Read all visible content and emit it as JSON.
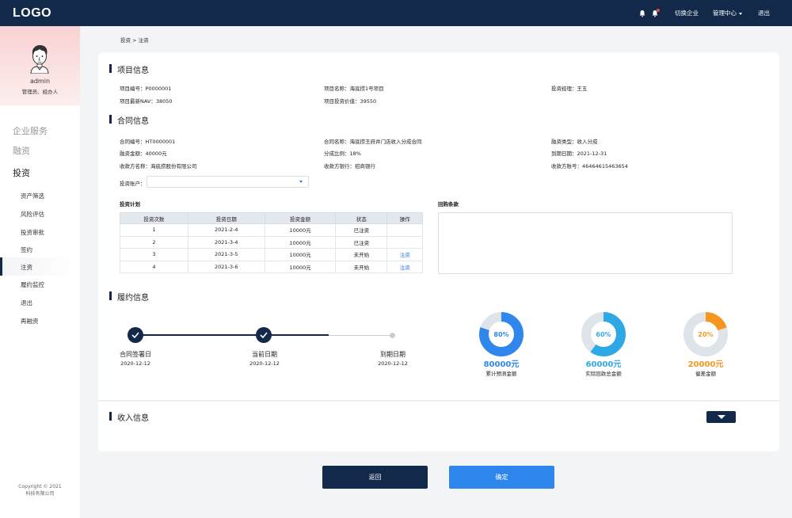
{
  "topbar": {
    "logo": "LOGO",
    "switch_company": "切换企业",
    "admin_center": "管理中心",
    "logout": "退出"
  },
  "profile": {
    "name": "admin",
    "role": "管理员、经办人"
  },
  "sidebar": {
    "groups": [
      "企业服务",
      "融资",
      "投资"
    ],
    "items": [
      "资产筛选",
      "风险评估",
      "投资审批",
      "签约",
      "注资",
      "履约监控",
      "退出",
      "再融资"
    ],
    "active_item": "注资",
    "copyright_line1": "Copyright © 2021",
    "copyright_line2": "科技有限公司"
  },
  "breadcrumb": "投资 > 注资",
  "project": {
    "title": "项目信息",
    "code": "项目编号：P0000001",
    "name": "项目名称：海底捞1号项目",
    "manager": "投资经理：王五",
    "nav": "项目最新NAV：38050",
    "value": "项目投资价值：39550"
  },
  "contract": {
    "title": "合同信息",
    "code": "合同编号：HT0000001",
    "name": "合同名称：海底捞王府井门店收入分成合同",
    "type": "融资类型：收入分成",
    "amount": "融资金额：40000元",
    "ratio": "分成比例：18%",
    "due": "到期日期：2021-12-31",
    "payee": "收款方名称：海底捞股份有限公司",
    "bank": "收款方银行：招商银行",
    "account": "收款方账号：46464615463654",
    "invest_account_label": "投资账户："
  },
  "plan": {
    "title": "投资计划",
    "headers": [
      "投资次数",
      "投资日期",
      "投资金额",
      "状态",
      "操作"
    ],
    "rows": [
      [
        "1",
        "2021-2-4",
        "10000元",
        "已注资",
        ""
      ],
      [
        "2",
        "2021-3-4",
        "10000元",
        "已注资",
        ""
      ],
      [
        "3",
        "2021-3-5",
        "10000元",
        "未开始",
        "注资"
      ],
      [
        "4",
        "2021-3-6",
        "10000元",
        "未开始",
        "注资"
      ]
    ]
  },
  "repurchase": {
    "title": "回购条款"
  },
  "performance": {
    "title": "履约信息",
    "milestones": [
      {
        "label": "合同签署日",
        "date": "2020-12-12"
      },
      {
        "label": "当前日期",
        "date": "2020-12-12"
      },
      {
        "label": "到期日期",
        "date": "2020-12-12"
      }
    ],
    "donuts": [
      {
        "percent": 0.8,
        "center": "80%",
        "value": "80000元",
        "label": "累计预测金额",
        "color": "#2f86ec",
        "track": "#dfe3ea",
        "valueColor": "#2f86ec"
      },
      {
        "percent": 0.6,
        "center": "60%",
        "value": "60000元",
        "label": "实际回款总金额",
        "color": "#2fa9e6",
        "track": "#dfe3ea",
        "valueColor": "#2fa9e6"
      },
      {
        "percent": 0.2,
        "center": "20%",
        "value": "20000元",
        "label": "偏差金额",
        "color": "#f7961e",
        "track": "#dfe3ea",
        "valueColor": "#f7961e"
      }
    ]
  },
  "income": {
    "title": "收入信息"
  },
  "buttons": {
    "back": "返回",
    "confirm": "确定"
  }
}
